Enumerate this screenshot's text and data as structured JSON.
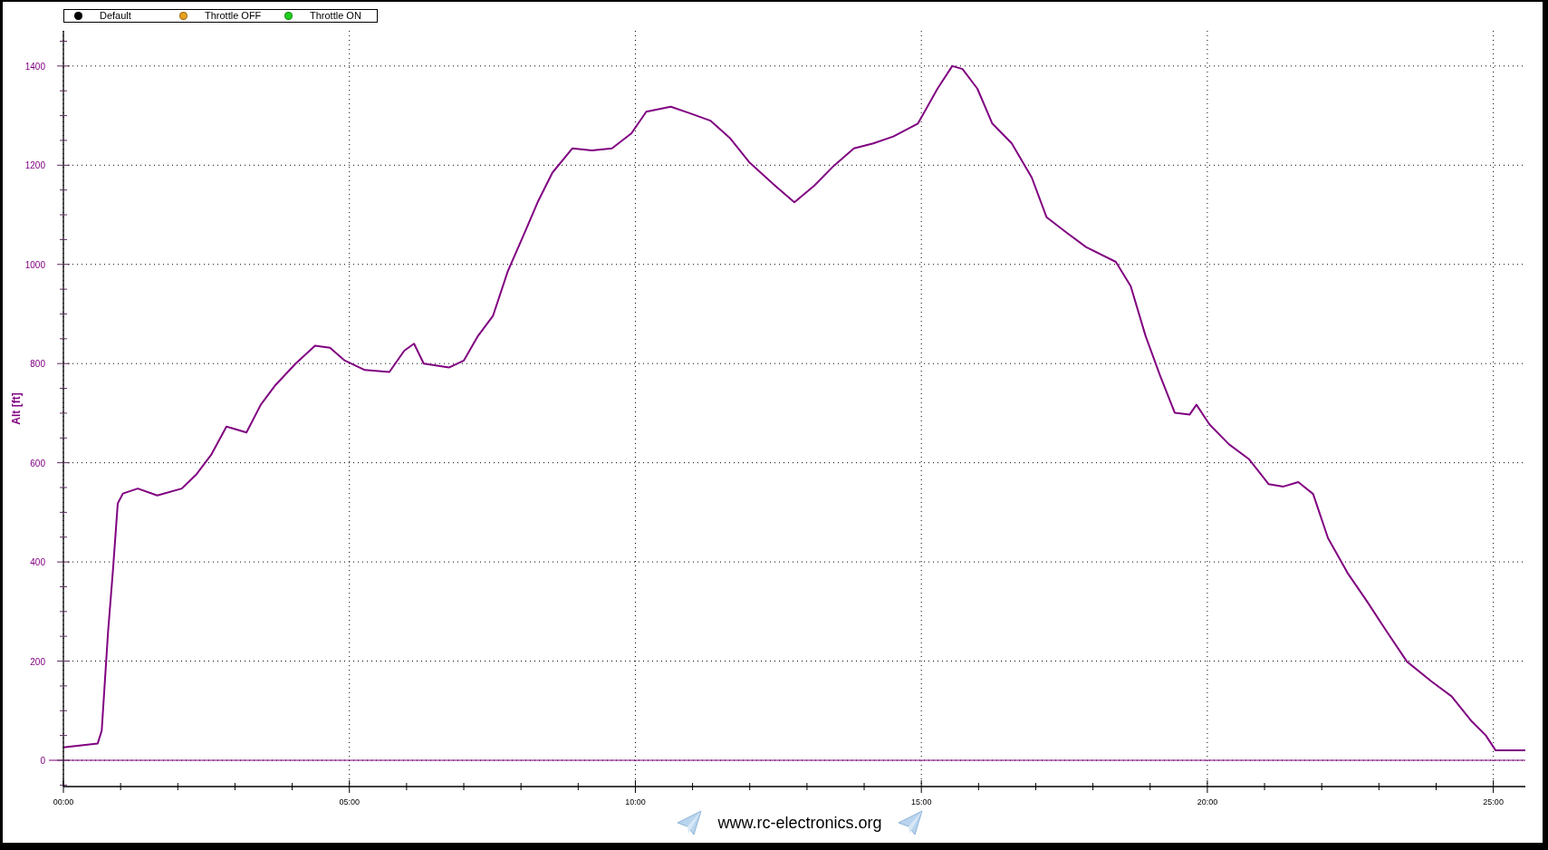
{
  "legend": [
    {
      "label": "Default",
      "color": "#000000"
    },
    {
      "label": "Throttle OFF",
      "color": "#e8a020"
    },
    {
      "label": "Throttle ON",
      "color": "#20d020"
    }
  ],
  "chart": {
    "chart_data": {
      "type": "line",
      "ylabel": "Alt [ft]",
      "xlim": [
        0,
        25.56
      ],
      "ylim": [
        -53,
        1471
      ],
      "xticks": [
        {
          "value": 0,
          "label": "00:00"
        },
        {
          "value": 5,
          "label": "05:00"
        },
        {
          "value": 10,
          "label": "10:00"
        },
        {
          "value": 15,
          "label": "15:00"
        },
        {
          "value": 20,
          "label": "20:00"
        },
        {
          "value": 25,
          "label": "25:00"
        }
      ],
      "yticks": [
        {
          "value": 0,
          "label": "0"
        },
        {
          "value": 200,
          "label": "200"
        },
        {
          "value": 400,
          "label": "400"
        },
        {
          "value": 600,
          "label": "600"
        },
        {
          "value": 800,
          "label": "800"
        },
        {
          "value": 1000,
          "label": "1000"
        },
        {
          "value": 1200,
          "label": "1200"
        },
        {
          "value": 1400,
          "label": "1400"
        }
      ],
      "x": [
        0,
        0.6,
        0.67,
        0.78,
        0.87,
        0.95,
        1.04,
        1.3,
        1.64,
        2.07,
        2.33,
        2.59,
        2.85,
        3.2,
        3.45,
        3.71,
        4.06,
        4.4,
        4.66,
        4.92,
        5.27,
        5.7,
        5.96,
        6.13,
        6.3,
        6.74,
        7.0,
        7.25,
        7.51,
        7.77,
        8.03,
        8.29,
        8.55,
        8.9,
        9.24,
        9.59,
        9.93,
        10.19,
        10.62,
        10.97,
        11.31,
        11.66,
        12.0,
        12.44,
        12.78,
        13.13,
        13.47,
        13.82,
        14.16,
        14.51,
        14.94,
        15.28,
        15.54,
        15.72,
        15.98,
        16.24,
        16.58,
        16.93,
        17.19,
        17.53,
        17.88,
        18.4,
        18.66,
        18.92,
        19.17,
        19.43,
        19.69,
        19.81,
        20.04,
        20.38,
        20.73,
        21.07,
        21.33,
        21.59,
        21.85,
        22.11,
        22.45,
        22.8,
        23.14,
        23.49,
        23.92,
        24.27,
        24.61,
        24.87,
        25.04,
        25.56
      ],
      "series": [
        {
          "color": "#800080",
          "values": [
            26,
            34,
            60,
            259,
            388,
            518,
            538,
            548,
            534,
            548,
            577,
            617,
            673,
            661,
            717,
            757,
            800,
            836,
            832,
            806,
            787,
            783,
            826,
            840,
            800,
            792,
            806,
            856,
            896,
            986,
            1055,
            1125,
            1185,
            1234,
            1230,
            1234,
            1264,
            1308,
            1318,
            1304,
            1290,
            1254,
            1205,
            1159,
            1125,
            1159,
            1199,
            1234,
            1244,
            1258,
            1284,
            1354,
            1400,
            1394,
            1354,
            1284,
            1244,
            1175,
            1095,
            1065,
            1035,
            1005,
            956,
            856,
            777,
            701,
            697,
            717,
            677,
            637,
            607,
            557,
            552,
            561,
            537,
            448,
            378,
            319,
            259,
            199,
            159,
            129,
            80,
            50,
            20,
            20
          ]
        }
      ],
      "grid": true,
      "ref_lines": [
        {
          "axis": "y",
          "value": 0,
          "color": "#800080"
        }
      ]
    }
  },
  "footer": {
    "text": "www.rc-electronics.org"
  }
}
